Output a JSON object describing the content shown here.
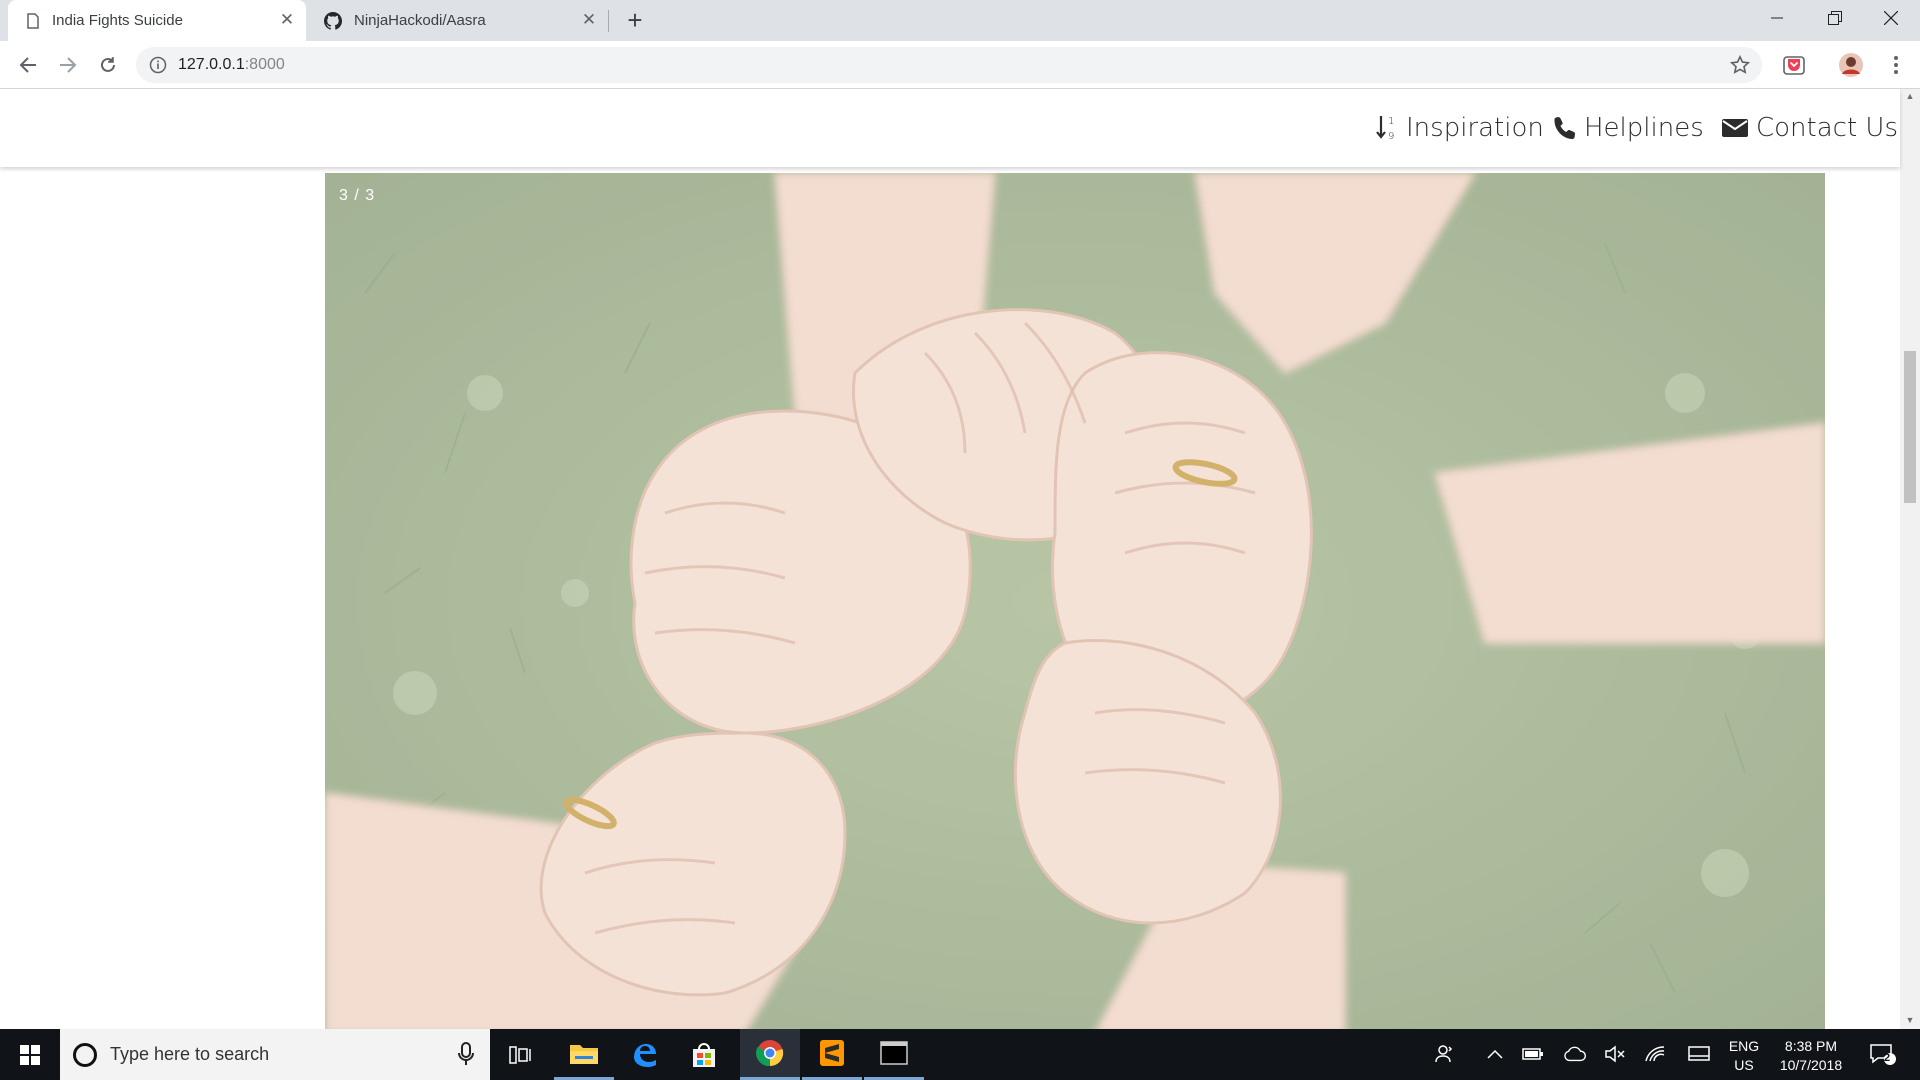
{
  "browser": {
    "tabs": [
      {
        "title": "India Fights Suicide",
        "active": true
      },
      {
        "title": "NinjaHackodi/Aasra",
        "active": false
      }
    ],
    "url_host": "127.0.0.1",
    "url_port": ":8000"
  },
  "site": {
    "nav": [
      {
        "label": "Inspiration",
        "icon": "sort-numeric-icon"
      },
      {
        "label": "Helplines",
        "icon": "phone-icon"
      },
      {
        "label": "Contact Us",
        "icon": "envelope-icon"
      }
    ],
    "slide_counter": "3 / 3"
  },
  "taskbar": {
    "search_placeholder": "Type here to search",
    "lang_top": "ENG",
    "lang_bottom": "US",
    "time": "8:38 PM",
    "date": "10/7/2018",
    "notifications": "2"
  },
  "colors": {
    "chrome_bg": "#dee1e6",
    "taskbar_bg": "#101419",
    "photo_grass": "#9fb38a",
    "photo_skin": "#f1d6c7"
  }
}
